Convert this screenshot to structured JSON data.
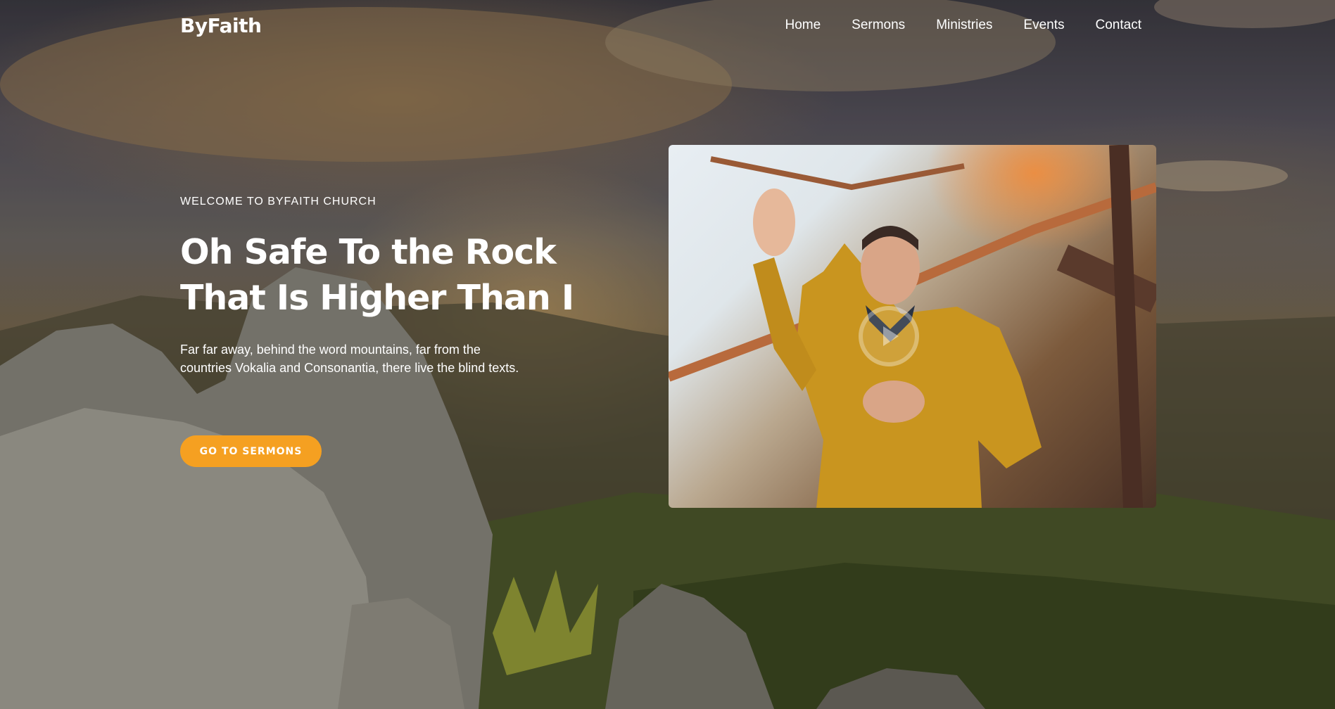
{
  "brand": {
    "name": "ByFaith"
  },
  "nav": {
    "items": [
      {
        "label": "Home"
      },
      {
        "label": "Sermons"
      },
      {
        "label": "Ministries"
      },
      {
        "label": "Events"
      },
      {
        "label": "Contact"
      }
    ]
  },
  "hero": {
    "eyebrow": "WELCOME TO BYFAITH CHURCH",
    "title_line1": "Oh Safe To the Rock",
    "title_line2": "That Is Higher Than I",
    "description": "Far far away, behind the word mountains, far from the countries Vokalia and Consonantia, there live the blind texts.",
    "cta_label": "GO TO SERMONS"
  },
  "video": {
    "icon": "play-icon"
  },
  "colors": {
    "accent": "#f5a021",
    "text": "#ffffff"
  }
}
